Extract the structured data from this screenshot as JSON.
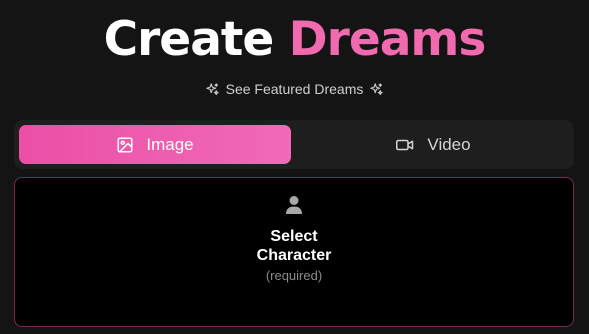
{
  "header": {
    "title_part1": "Create",
    "title_part2": "Dreams",
    "featured_link": "See Featured Dreams",
    "accent_color": "#f06aaf"
  },
  "tabs": {
    "image_label": "Image",
    "video_label": "Video",
    "selected": "Image",
    "image_icon": "image-icon",
    "video_icon": "video-camera-icon"
  },
  "character": {
    "icon": "user-icon",
    "title_line1": "Select",
    "title_line2": "Character",
    "required_note": "(required)"
  }
}
